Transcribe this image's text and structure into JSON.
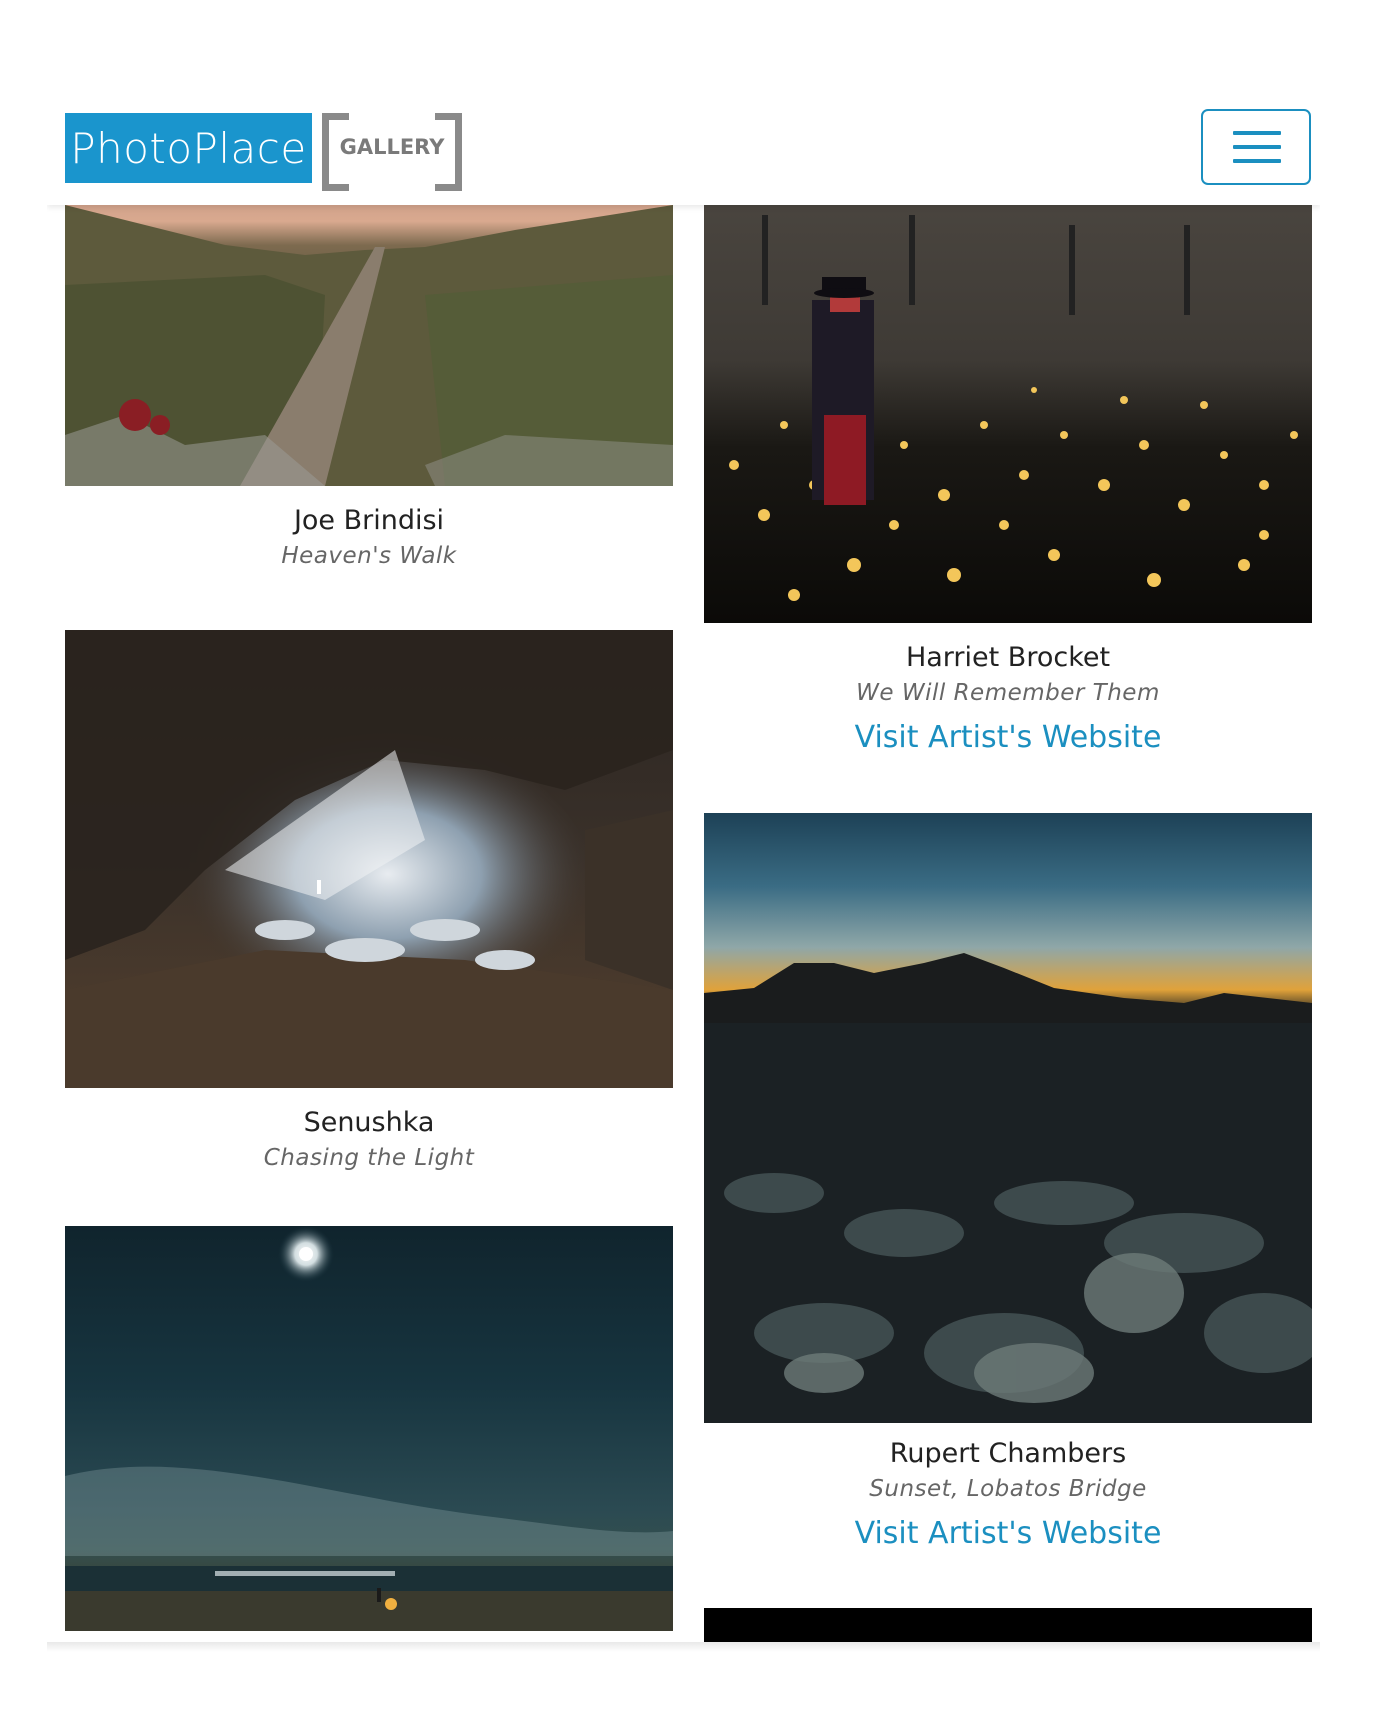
{
  "logo": {
    "brand": "PhotoPlace",
    "sub": "GALLERY"
  },
  "menu": {
    "icon": "hamburger-menu-icon"
  },
  "gallery": [
    {
      "artist": "Joe Brindisi",
      "title": "Heaven's Walk",
      "image": "boardwalk-dunes-sunset"
    },
    {
      "artist": "Harriet Brocket",
      "title": "We Will Remember Them",
      "link": "Visit Artist's Website",
      "image": "beefeater-lights-castle"
    },
    {
      "artist": "Senushka",
      "title": "Chasing the Light",
      "image": "lava-cave-light-beam"
    },
    {
      "artist": "Rupert Chambers",
      "title": "Sunset, Lobatos Bridge",
      "link": "Visit Artist's Website",
      "image": "desert-sagebrush-dusk"
    },
    {
      "image": "moonlit-beach-campfire"
    },
    {
      "image": "black-partial"
    }
  ]
}
